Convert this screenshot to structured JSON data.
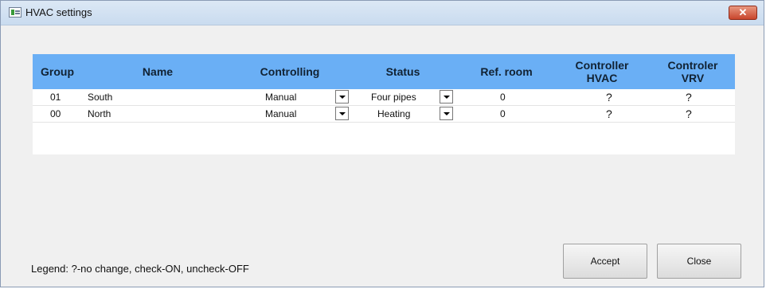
{
  "window": {
    "title": "HVAC settings",
    "close_glyph": "✕"
  },
  "grid": {
    "columns": [
      "Group",
      "Name",
      "Controlling",
      "Status",
      "Ref. room",
      "Controller\nHVAC",
      "Controler\nVRV"
    ],
    "rows": [
      {
        "group": "01",
        "name": "South",
        "controlling": "Manual",
        "status": "Four pipes",
        "ref_room": "0",
        "controller_hvac": "?",
        "controller_vrv": "?"
      },
      {
        "group": "00",
        "name": "North",
        "controlling": "Manual",
        "status": "Heating",
        "ref_room": "0",
        "controller_hvac": "?",
        "controller_vrv": "?"
      }
    ]
  },
  "legend": "Legend: ?-no change, check-ON, uncheck-OFF",
  "buttons": {
    "accept": "Accept",
    "close": "Close"
  },
  "colors": {
    "header_bg": "#6aaff5",
    "close_button": "#c8452c"
  },
  "icons": {
    "app": "window-app-icon",
    "close": "close-icon",
    "dropdown": "chevron-down-icon"
  }
}
